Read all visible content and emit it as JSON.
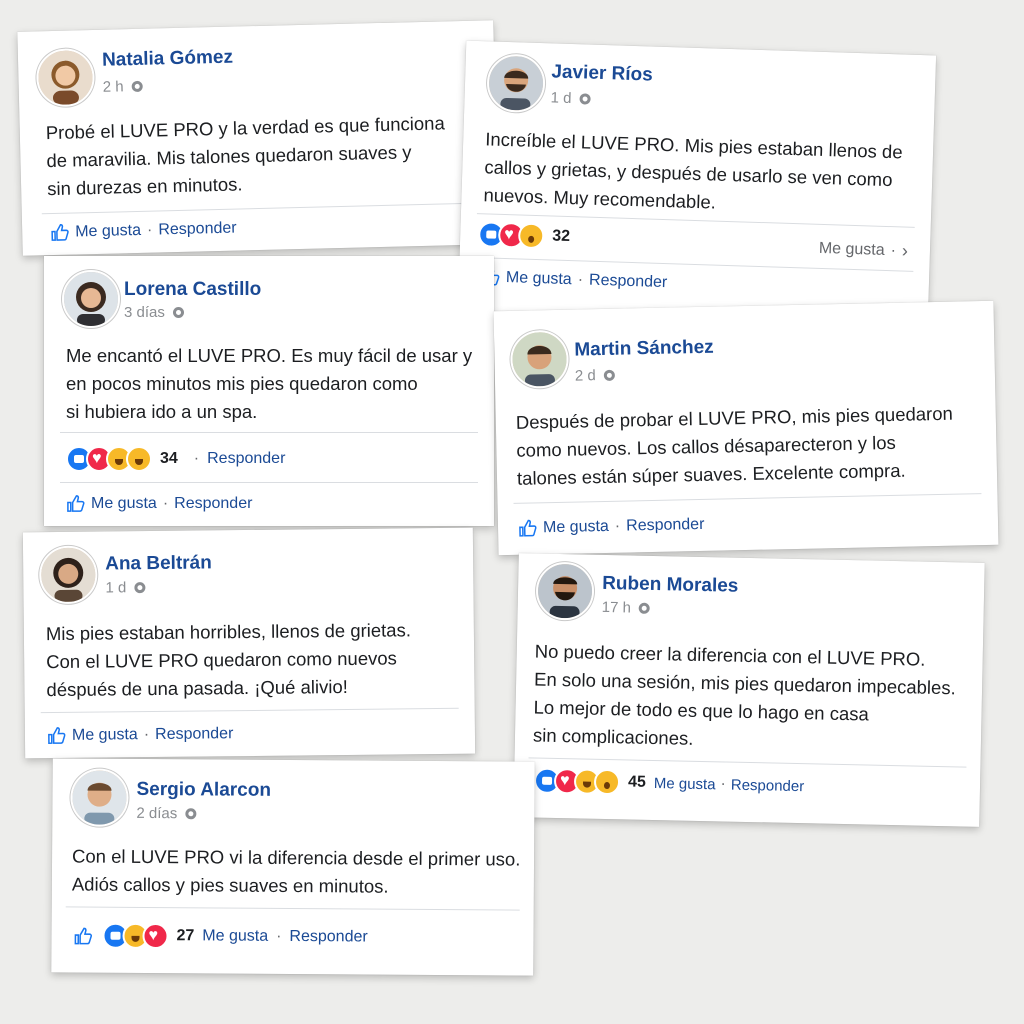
{
  "posts": [
    {
      "name": "Natalia Gómez",
      "time": "2 h",
      "lines": [
        "Probé el LUVE PRO y la verdad es que funciona",
        "de maravilia. Mis talones quedaron suaves y",
        "sin durezas en minutos."
      ],
      "like": "Me gusta",
      "reply": "Responder"
    },
    {
      "name": "Javier Ríos",
      "time": "1 d",
      "lines": [
        "Increíble el LUVE PRO. Mis pies estaban llenos de",
        "callos y grietas, y después de usarlo se ven como",
        "nuevos. Muy recomendable."
      ],
      "count": "32",
      "right_label": "Me gusta",
      "like": "Me gusta",
      "reply": "Responder"
    },
    {
      "name": "Lorena Castillo",
      "time": "3 días",
      "lines": [
        "Me encantó el LUVE PRO. Es muy fácil de usar y",
        "en pocos minutos mis pies quedaron como",
        "si hubiera ido a un spa."
      ],
      "count": "34",
      "reply_top": "Responder",
      "like": "Me gusta",
      "reply": "Responder"
    },
    {
      "name": "Martin Sánchez",
      "time": "2 d",
      "lines": [
        "Después de probar el LUVE PRO, mis pies quedaron",
        "como nuevos. Los callos désaparecteron y los",
        "talones están súper suaves. Excelente compra."
      ],
      "like": "Me gusta",
      "reply": "Responder"
    },
    {
      "name": "Ana Beltrán",
      "time": "1 d",
      "lines": [
        "Mis pies estaban horribles, llenos de grietas.",
        "Con el LUVE PRO quedaron como nuevos",
        "déspués de una pasada. ¡Qué alivio!"
      ],
      "like": "Me gusta",
      "reply": "Responder"
    },
    {
      "name": "Ruben Morales",
      "time": "17 h",
      "lines": [
        "No puedo creer la diferencia con el LUVE PRO.",
        "En solo una sesión, mis pies quedaron impecables.",
        "Lo mejor de todo es que lo hago en casa",
        "sin complicaciones."
      ],
      "count": "45",
      "like": "Me gusta",
      "reply": "Responder"
    },
    {
      "name": "Sergio Alarcon",
      "time": "2 días",
      "lines": [
        "Con el LUVE PRO vi la diferencia desde el primer uso.",
        "Adiós callos y pies suaves en minutos."
      ],
      "count": "27",
      "like": "Me gusta",
      "reply": "Responder"
    }
  ],
  "colors": {
    "name": "#1b4a95",
    "text": "#1c1e21",
    "muted": "#8a8d91",
    "like": "#1877f2",
    "love": "#f0284a",
    "emoji": "#f7b928"
  },
  "icons": [
    "thumbs-up-icon",
    "globe-icon",
    "like-reaction-icon",
    "love-reaction-icon",
    "haha-reaction-icon",
    "wow-reaction-icon",
    "care-reaction-icon",
    "chevron-right-icon"
  ]
}
